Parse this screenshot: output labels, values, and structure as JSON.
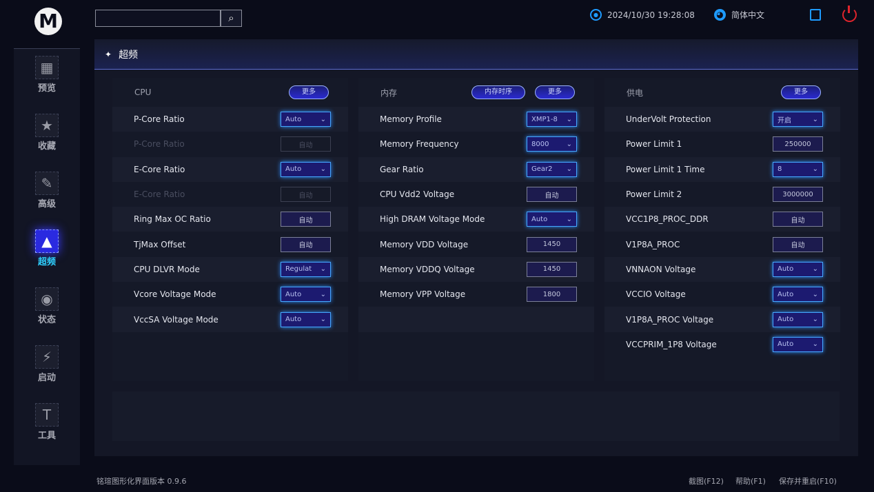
{
  "app": {
    "logo": "M",
    "search_placeholder": "",
    "version": "铭瑄图形化界面版本 0.9.6"
  },
  "topbar": {
    "datetime": "2024/10/30 19:28:08",
    "language": "简体中文",
    "icons": [
      "gear-icon",
      "globe-icon",
      "save-icon",
      "power-icon"
    ],
    "power_color": "#e0242c",
    "accent": "#1e9bff"
  },
  "sidebar": {
    "items": [
      {
        "label": "预览",
        "icon": "dashboard-icon",
        "glyph": "▦"
      },
      {
        "label": "收藏",
        "icon": "star-icon",
        "glyph": "★"
      },
      {
        "label": "高级",
        "icon": "wrench-icon",
        "glyph": "✎"
      },
      {
        "label": "超频",
        "icon": "rocket-icon",
        "glyph": "▲",
        "active": true
      },
      {
        "label": "状态",
        "icon": "eye-icon",
        "glyph": "◉"
      },
      {
        "label": "启动",
        "icon": "ssd-icon",
        "glyph": "⚡"
      },
      {
        "label": "工具",
        "icon": "hammer-icon",
        "glyph": "T"
      }
    ]
  },
  "main": {
    "title": "超频",
    "columns": [
      {
        "title": "CPU",
        "buttons": [
          "更多"
        ],
        "rows": [
          {
            "name": "P-Core Ratio",
            "type": "select",
            "value": "Auto"
          },
          {
            "name": "P-Core Ratio",
            "type": "input",
            "value": "自动",
            "disabled": true
          },
          {
            "name": "E-Core Ratio",
            "type": "select",
            "value": "Auto"
          },
          {
            "name": "E-Core Ratio",
            "type": "input",
            "value": "自动",
            "disabled": true
          },
          {
            "name": "Ring Max OC Ratio",
            "type": "input",
            "value": "自动"
          },
          {
            "name": "TjMax Offset",
            "type": "input",
            "value": "自动"
          },
          {
            "name": "CPU DLVR Mode",
            "type": "select",
            "value": "Regulat"
          },
          {
            "name": "Vcore Voltage Mode",
            "type": "select",
            "value": "Auto"
          },
          {
            "name": "VccSA Voltage Mode",
            "type": "select",
            "value": "Auto"
          },
          {
            "name": "",
            "type": "empty"
          }
        ]
      },
      {
        "title": "内存",
        "buttons": [
          "内存时序",
          "更多"
        ],
        "rows": [
          {
            "name": "Memory Profile",
            "type": "select",
            "value": "XMP1-8"
          },
          {
            "name": "Memory Frequency",
            "type": "select",
            "value": "8000"
          },
          {
            "name": "Gear Ratio",
            "type": "select",
            "value": "Gear2"
          },
          {
            "name": "CPU Vdd2 Voltage",
            "type": "input",
            "value": "自动"
          },
          {
            "name": "High DRAM Voltage Mode",
            "type": "select",
            "value": "Auto"
          },
          {
            "name": "Memory VDD Voltage",
            "type": "input",
            "value": "1450"
          },
          {
            "name": "Memory VDDQ Voltage",
            "type": "input",
            "value": "1450"
          },
          {
            "name": "Memory VPP Voltage",
            "type": "input",
            "value": "1800"
          },
          {
            "name": "",
            "type": "empty"
          },
          {
            "name": "",
            "type": "empty"
          }
        ]
      },
      {
        "title": "供电",
        "buttons": [
          "更多"
        ],
        "rows": [
          {
            "name": "UnderVolt Protection",
            "type": "select",
            "value": "开启"
          },
          {
            "name": "Power Limit 1",
            "type": "input",
            "value": "250000"
          },
          {
            "name": "Power Limit 1 Time",
            "type": "select",
            "value": "8"
          },
          {
            "name": "Power Limit 2",
            "type": "input",
            "value": "3000000"
          },
          {
            "name": "VCC1P8_PROC_DDR",
            "type": "input",
            "value": "自动"
          },
          {
            "name": "V1P8A_PROC",
            "type": "input",
            "value": "自动"
          },
          {
            "name": "VNNAON Voltage",
            "type": "select",
            "value": "Auto"
          },
          {
            "name": "VCCIO Voltage",
            "type": "select",
            "value": "Auto"
          },
          {
            "name": "V1P8A_PROC Voltage",
            "type": "select",
            "value": "Auto"
          },
          {
            "name": "VCCPRIM_1P8 Voltage",
            "type": "select",
            "value": "Auto"
          }
        ]
      }
    ]
  },
  "footer": {
    "screenshot": "截图(F12)",
    "help": "帮助(F1)",
    "save_restart": "保存并重启(F10)"
  }
}
